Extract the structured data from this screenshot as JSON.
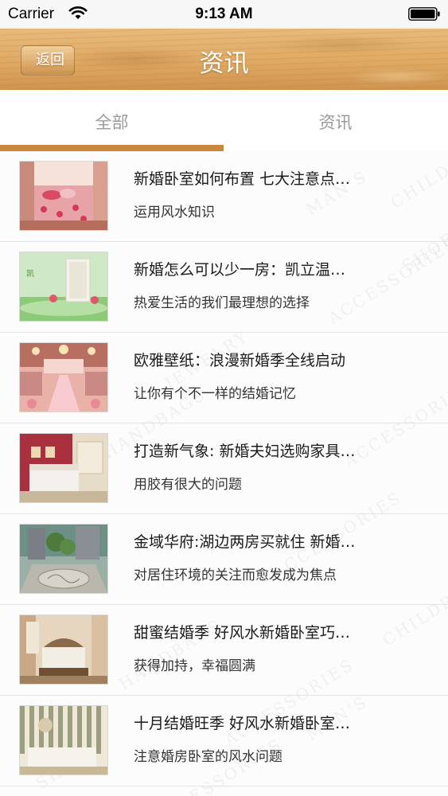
{
  "status_bar": {
    "carrier": "Carrier",
    "time": "9:13 AM"
  },
  "nav": {
    "back_label": "返回",
    "title": "资讯"
  },
  "tabs": [
    {
      "label": "全部",
      "selected": true
    },
    {
      "label": "资讯",
      "selected": false
    }
  ],
  "colors": {
    "accent": "#c9873d",
    "wood": "#dfa963",
    "tab_text": "#9a9a9a"
  },
  "watermark_words": [
    "MAN'S",
    "ACCESSORIES",
    "CHILDREN'S",
    "HANDBAGS",
    "SHOES",
    "JEWELRY"
  ],
  "articles": [
    {
      "title": "新婚卧室如何布置 七大注意点…",
      "subtitle": "运用风水知识",
      "thumbnail": "pink-bedroom-photo"
    },
    {
      "title": "新婚怎么可以少一房：凯立温…",
      "subtitle": "热爱生活的我们最理想的选择",
      "thumbnail": "green-product-ad-photo"
    },
    {
      "title": "欧雅壁纸：浪漫新婚季全线启动",
      "subtitle": "让你有个不一样的结婚记忆",
      "thumbnail": "wedding-hall-photo"
    },
    {
      "title": "打造新气象: 新婚夫妇选购家具…",
      "subtitle": "用胶有很大的问题",
      "thumbnail": "red-wall-bedroom-photo"
    },
    {
      "title": "金域华府:湖边两房买就住 新婚…",
      "subtitle": "对居住环境的关注而愈发成为焦点",
      "thumbnail": "plaza-carved-stone-photo"
    },
    {
      "title": "甜蜜结婚季 好风水新婚卧室巧…",
      "subtitle": "获得加持，幸福圆满",
      "thumbnail": "classic-bedroom-photo"
    },
    {
      "title": "十月结婚旺季 好风水新婚卧室…",
      "subtitle": "注意婚房卧室的风水问题",
      "thumbnail": "striped-wall-bedroom-photo"
    }
  ]
}
